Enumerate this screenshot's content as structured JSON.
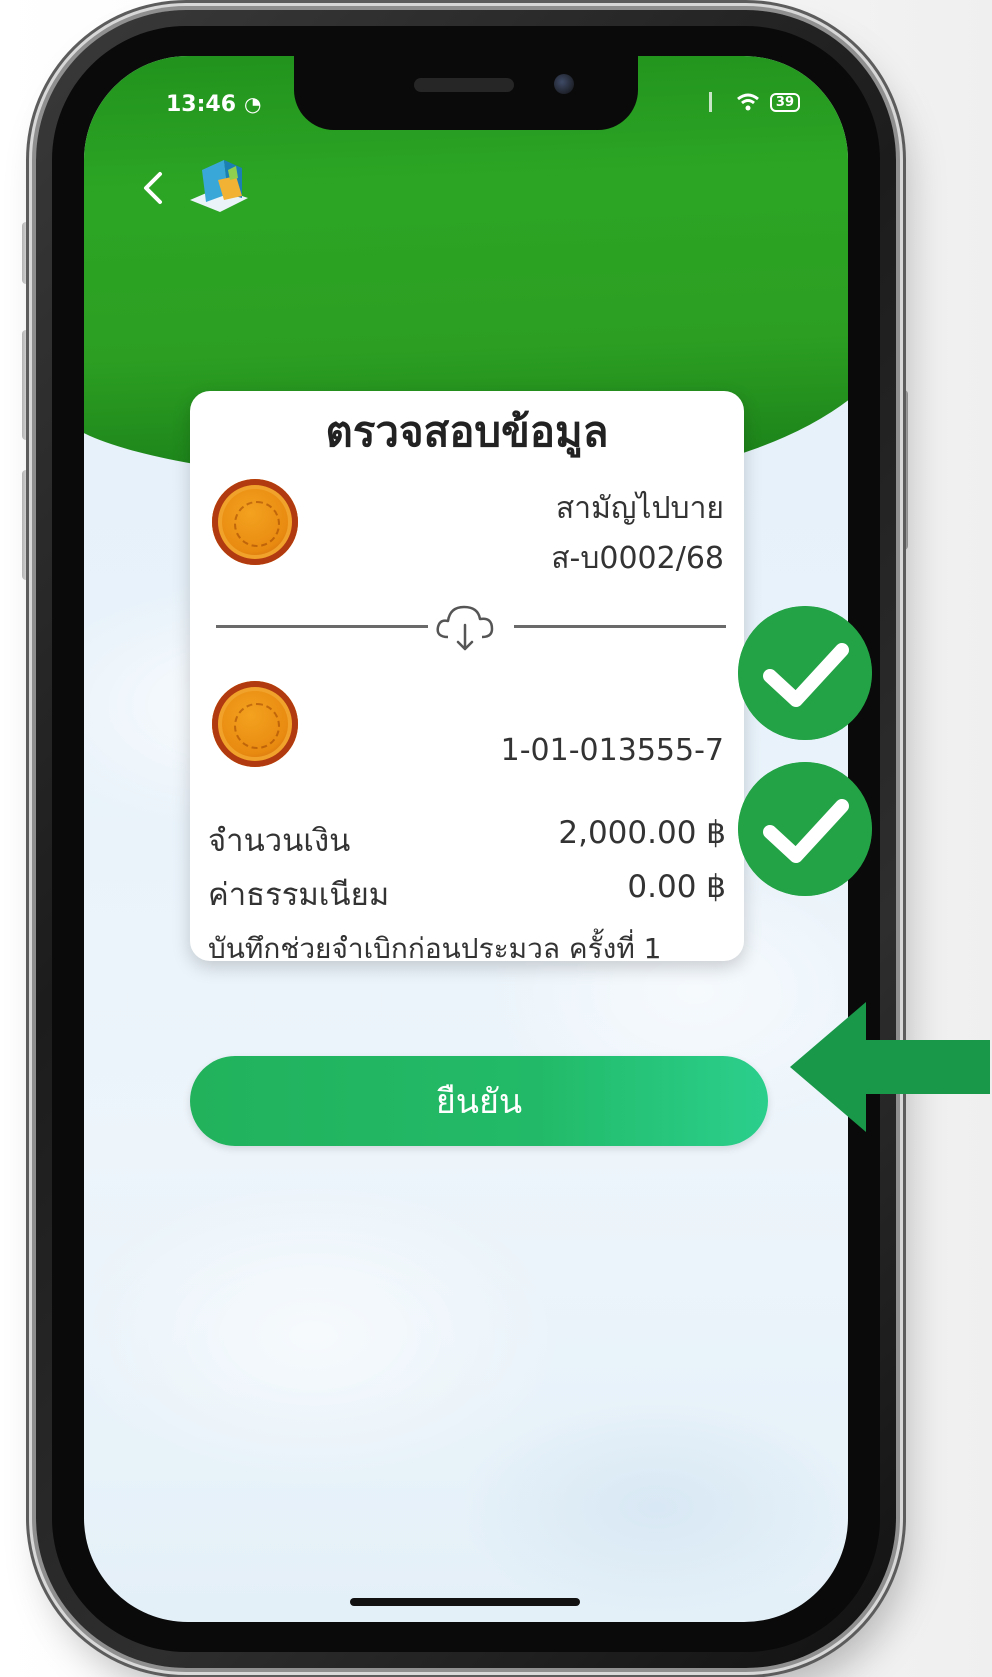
{
  "status_bar": {
    "time": "13:46",
    "battery": "39"
  },
  "header": {
    "back_label": "<"
  },
  "card": {
    "title": "ตรวจสอบข้อมูล",
    "from_account": {
      "type": "สามัญไปบาย",
      "number": "ส-บ0002/68"
    },
    "to_account": {
      "number": "1-01-013555-7"
    },
    "amount_label": "จำนวนเงิน",
    "amount_value": "2,000.00 ฿",
    "fee_label": "ค่าธรรมเนียม",
    "fee_value": "0.00 ฿",
    "memo": "บันทึกช่วยจำเบิกก่อนประมวล ครั้งที่ 1"
  },
  "confirm_button": "ยืนยัน",
  "colors": {
    "header_green": "#2ca524",
    "button_green": "#22b25c",
    "check_green": "#23a346",
    "arrow_green": "#19984a"
  },
  "icons": {
    "back": "chevron-left-icon",
    "logo": "app-logo-icon",
    "coin": "coin-icon",
    "transfer": "cloud-download-icon",
    "check": "check-icon",
    "arrow": "arrow-left-icon"
  }
}
